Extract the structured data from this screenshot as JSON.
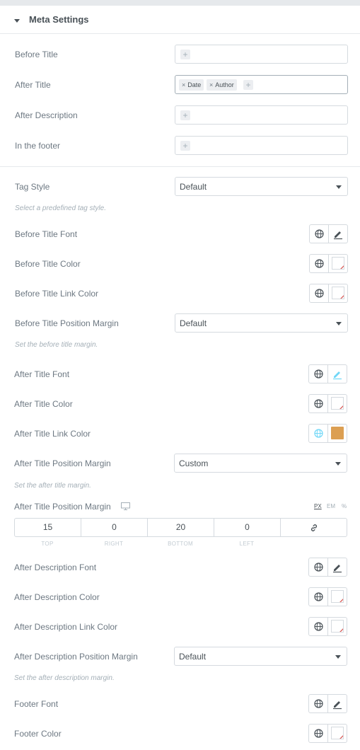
{
  "panel": {
    "section_title": "Meta Settings"
  },
  "meta_positions": {
    "before_title": {
      "label": "Before Title",
      "tags": []
    },
    "after_title": {
      "label": "After Title",
      "tags": [
        "Date",
        "Author"
      ]
    },
    "after_description": {
      "label": "After Description",
      "tags": []
    },
    "in_footer": {
      "label": "In the footer",
      "tags": []
    },
    "add_symbol": "+",
    "remove_symbol": "×"
  },
  "tag_style": {
    "label": "Tag Style",
    "value": "Default",
    "hint": "Select a predefined tag style."
  },
  "before_title": {
    "font_label": "Before Title Font",
    "color_label": "Before Title Color",
    "link_color_label": "Before Title Link Color",
    "margin_label": "Before Title Position Margin",
    "margin_value": "Default",
    "margin_hint": "Set the before title margin."
  },
  "after_title": {
    "font_label": "After Title Font",
    "color_label": "After Title Color",
    "link_color_label": "After Title Link Color",
    "link_color_value": "#dc9f52",
    "margin_label": "After Title Position Margin",
    "margin_value": "Custom",
    "margin_hint": "Set the after title margin.",
    "custom_margin_label": "After Title Position Margin",
    "units": [
      "PX",
      "EM",
      "%"
    ],
    "active_unit": "PX",
    "dimensions": {
      "top": {
        "label": "TOP",
        "value": "15"
      },
      "right": {
        "label": "RIGHT",
        "value": "0"
      },
      "bottom": {
        "label": "BOTTOM",
        "value": "20"
      },
      "left": {
        "label": "LEFT",
        "value": "0"
      }
    }
  },
  "after_description": {
    "font_label": "After Description Font",
    "color_label": "After Description Color",
    "link_color_label": "After Description Link Color",
    "margin_label": "After Description Position Margin",
    "margin_value": "Default",
    "margin_hint": "Set the after description margin."
  },
  "footer": {
    "font_label": "Footer Font",
    "color_label": "Footer Color"
  },
  "icons": {
    "globe": "globe-icon",
    "pencil": "pencil-icon",
    "monitor": "desktop-icon",
    "link": "link-icon",
    "caret": "caret-down-icon"
  },
  "colors": {
    "accent": "#71d7f7",
    "border": "#d5dadf",
    "text": "#6d7882",
    "empty_swatch_slash": "#d9534f"
  }
}
